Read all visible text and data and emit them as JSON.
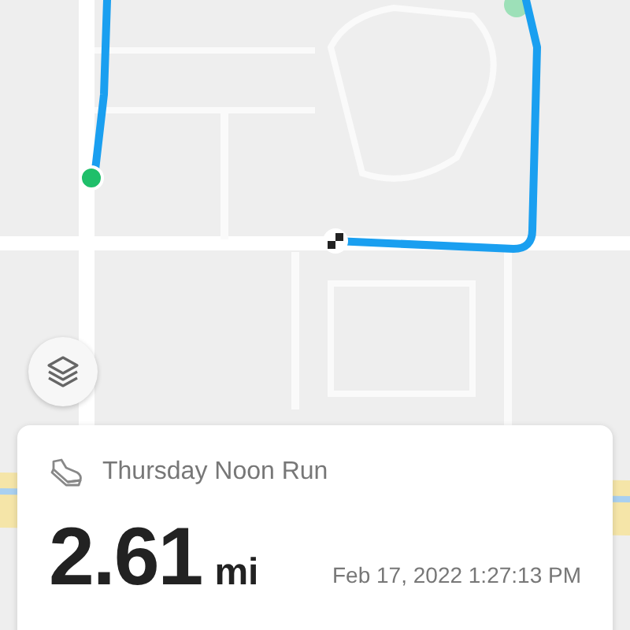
{
  "activity": {
    "title": "Thursday Noon Run",
    "distance": "2.61",
    "unit": "mi",
    "date": "Feb 17, 2022 1:27:13 PM"
  }
}
